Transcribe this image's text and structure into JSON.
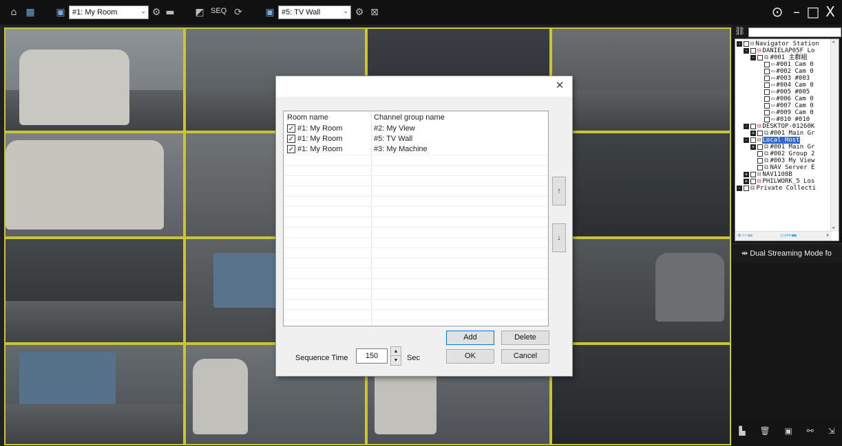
{
  "toolbar": {
    "room_combo": "#1: My Room",
    "seq_label": "SEQ",
    "group_combo": "#5: TV Wall"
  },
  "tree": {
    "nodes": [
      {
        "label": "Navigator Station",
        "icon": "station-icon"
      },
      {
        "label": "DANIELAP05F Lo",
        "icon": "server-icon"
      },
      {
        "label": "#001 主群組",
        "icon": "group-icon"
      },
      {
        "label": "#001 Cam 0",
        "icon": "camera-icon"
      },
      {
        "label": "#002 Cam 0",
        "icon": "camera-icon"
      },
      {
        "label": "#003 #003",
        "icon": "camera-icon"
      },
      {
        "label": "#004 Cam 0",
        "icon": "camera-icon"
      },
      {
        "label": "#005 #005",
        "icon": "camera-icon"
      },
      {
        "label": "#006 Cam 0",
        "icon": "camera-icon"
      },
      {
        "label": "#007 Cam 0",
        "icon": "camera-icon"
      },
      {
        "label": "#009 Cam 0",
        "icon": "camera-icon"
      },
      {
        "label": "#010 #010",
        "icon": "camera-icon"
      },
      {
        "label": "DESKTOP-01260K",
        "icon": "server-icon"
      },
      {
        "label": "#001 Main Gr",
        "icon": "group-icon"
      },
      {
        "label": "Local Host",
        "icon": "server-icon"
      },
      {
        "label": "#001 Main Gr",
        "icon": "group-icon"
      },
      {
        "label": "#002 Group 2",
        "icon": "group-icon"
      },
      {
        "label": "#003 My View",
        "icon": "group-icon"
      },
      {
        "label": "NAV Server E",
        "icon": "group-icon"
      },
      {
        "label": "NAV1108B",
        "icon": "server-icon"
      },
      {
        "label": "PHILWORK_5 Los",
        "icon": "server-icon"
      },
      {
        "label": "Private Collecti",
        "icon": "collection-icon"
      }
    ]
  },
  "panel": {
    "dual_streaming_title": "Dual Streaming Mode fo"
  },
  "dialog": {
    "columns": [
      "Room name",
      "Channel group name"
    ],
    "rows": [
      {
        "checked": true,
        "room": "#1: My Room",
        "group": "#2: My View"
      },
      {
        "checked": true,
        "room": "#1: My Room",
        "group": "#5: TV Wall"
      },
      {
        "checked": true,
        "room": "#1: My Room",
        "group": "#3: My Machine"
      }
    ],
    "up_label": "↑",
    "down_label": "↓",
    "add_label": "Add",
    "delete_label": "Delete",
    "ok_label": "OK",
    "cancel_label": "Cancel",
    "sequence_time_label": "Sequence Time",
    "sequence_time_value": "150",
    "sequence_unit": "Sec"
  }
}
